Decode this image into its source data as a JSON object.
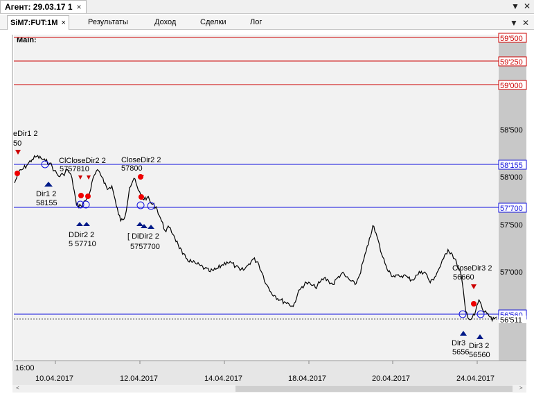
{
  "window": {
    "title": "Агент: 29.03.17 1",
    "close": "×",
    "buttons": [
      "▼",
      "✕"
    ]
  },
  "tabs": {
    "active": "SiM7:FUT:1M",
    "active_close": "×",
    "items": [
      "Результаты",
      "Доход",
      "Сделки",
      "Лог"
    ],
    "controls": [
      "▼",
      "✕"
    ]
  },
  "chart": {
    "panel_label": "Main:",
    "time_label": "16:00",
    "x_ticks": [
      "10.04.2017",
      "12.04.2017",
      "14.04.2017",
      "18.04.2017",
      "20.04.2017",
      "24.04.2017"
    ],
    "y_ticks": [
      "58'500",
      "58'000",
      "57'500",
      "57'000"
    ],
    "red_levels": [
      "59'500",
      "59'250",
      "59'000"
    ],
    "blue_levels": [
      "58'155",
      "57'700",
      "56'560"
    ],
    "last_price_label": "56'511",
    "annotations": [
      {
        "text": "eDir1 2"
      },
      {
        "text": "50"
      },
      {
        "text": "Dir1 2"
      },
      {
        "text": "58155"
      },
      {
        "text": "ClCloseDir2 2"
      },
      {
        "text": "5757810"
      },
      {
        "text": "CloseDir2 2"
      },
      {
        "text": "57800"
      },
      {
        "text": "DDir2 2"
      },
      {
        "text": "5 57710"
      },
      {
        "text": "[ DiDir2 2"
      },
      {
        "text": "5757700"
      },
      {
        "text": "CloseDir3 2"
      },
      {
        "text": "56660"
      },
      {
        "text": "Dir3"
      },
      {
        "text": "5656"
      },
      {
        "text": "Dir3 2"
      },
      {
        "text": "56560"
      }
    ],
    "colors": {
      "red_level": "#cc0000",
      "blue_level": "#1010dd",
      "price": "#000000",
      "plot_bg": "#f2f2f2",
      "axis_bg": "#c8c8c8"
    }
  },
  "chart_data": {
    "type": "line",
    "series": [
      {
        "values": [
          57950,
          58070,
          58100,
          58150,
          58200,
          58230,
          58210,
          58180,
          58160,
          58080,
          58020,
          58040,
          58090,
          58000,
          57720,
          57710,
          57760,
          57850,
          58030,
          58080,
          58000,
          57880,
          57920,
          57710,
          57550,
          57600,
          57900,
          58000,
          57870,
          57780,
          57800,
          57730,
          57700,
          57580,
          57450,
          57480,
          57400,
          57300,
          57200,
          57150,
          57120,
          57100,
          57080,
          57050,
          57020,
          57030,
          57050,
          57090,
          57120,
          57110,
          57070,
          57030,
          57040,
          57100,
          57150,
          57120,
          57000,
          56880,
          56800,
          56760,
          56720,
          56700,
          56680,
          56650,
          56780,
          56860,
          56900,
          56880,
          56850,
          56900,
          56950,
          56920,
          56880,
          56950,
          57000,
          56960,
          56920,
          56880,
          56980,
          57150,
          57300,
          57500,
          57380,
          57200,
          57080,
          57000,
          56960,
          56970,
          56980,
          56950,
          56930,
          56980,
          57020,
          57000,
          56900,
          56960,
          57050,
          57150,
          57250,
          57200,
          57100,
          56980,
          56600,
          56510,
          56560,
          56720,
          56600,
          56580,
          56500,
          56540
        ]
      }
    ],
    "xlabels": [
      "10.04.2017",
      "12.04.2017",
      "14.04.2017",
      "18.04.2017",
      "20.04.2017",
      "24.04.2017"
    ],
    "ylim": [
      56250,
      59600
    ],
    "hlines_red": [
      59500,
      59250,
      59000
    ],
    "hlines_blue": [
      58155,
      57700,
      56560
    ],
    "last_price": 56511
  }
}
